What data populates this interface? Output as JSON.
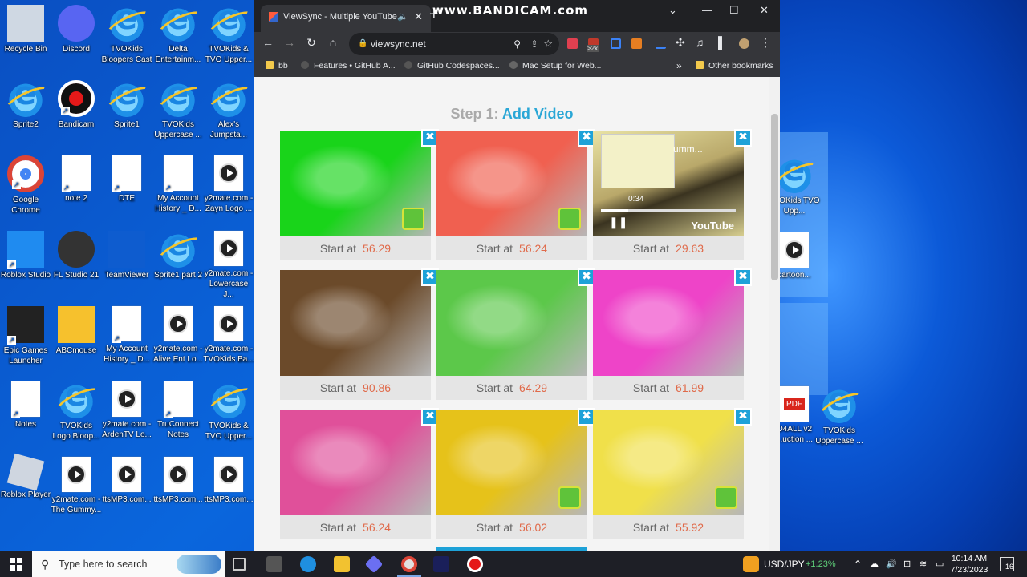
{
  "desktop": {
    "icons": [
      {
        "label": "Recycle Bin",
        "icon": "recycle-bin-icon"
      },
      {
        "label": "Discord",
        "icon": "discord-icon"
      },
      {
        "label": "TVOKids Bloopers Cast",
        "icon": "ie-icon"
      },
      {
        "label": "Delta Entertainm...",
        "icon": "ie-icon"
      },
      {
        "label": "TVOKids & TVO Upper...",
        "icon": "ie-icon"
      },
      {
        "label": "Sprite2",
        "icon": "ie-icon"
      },
      {
        "label": "Bandicam",
        "icon": "bandicam-icon"
      },
      {
        "label": "Sprite1",
        "icon": "ie-icon"
      },
      {
        "label": "TVOKids Uppercase ...",
        "icon": "ie-icon"
      },
      {
        "label": "Alex's Jumpsta...",
        "icon": "ie-icon"
      },
      {
        "label": "Google Chrome",
        "icon": "chrome-icon"
      },
      {
        "label": "note 2",
        "icon": "document-icon"
      },
      {
        "label": "DTE",
        "icon": "document-icon"
      },
      {
        "label": "My Account History _ D...",
        "icon": "document-icon"
      },
      {
        "label": "y2mate.com - Zayn Logo ...",
        "icon": "media-file-icon"
      },
      {
        "label": "Roblox Studio",
        "icon": "roblox-studio-icon"
      },
      {
        "label": "FL Studio 21",
        "icon": "fl-studio-icon"
      },
      {
        "label": "TeamViewer",
        "icon": "teamviewer-icon"
      },
      {
        "label": "Sprite1 part 2",
        "icon": "ie-icon"
      },
      {
        "label": "y2mate.com - Lowercase J...",
        "icon": "media-file-icon"
      },
      {
        "label": "Epic Games Launcher",
        "icon": "epic-games-icon"
      },
      {
        "label": "ABCmouse",
        "icon": "abcmouse-icon"
      },
      {
        "label": "My Account History _ D...",
        "icon": "document-icon"
      },
      {
        "label": "y2mate.com - Alive Ent Lo...",
        "icon": "media-file-icon"
      },
      {
        "label": "y2mate.com - TVOKids Ba...",
        "icon": "media-file-icon"
      },
      {
        "label": "Notes",
        "icon": "document-icon"
      },
      {
        "label": "TVOKids Logo Bloop...",
        "icon": "ie-icon"
      },
      {
        "label": "y2mate.com - ArdenTV Lo...",
        "icon": "media-file-icon"
      },
      {
        "label": "TruConnect Notes",
        "icon": "document-icon"
      },
      {
        "label": "TVOKids & TVO Upper...",
        "icon": "ie-icon"
      },
      {
        "label": "Roblox Player",
        "icon": "roblox-icon"
      },
      {
        "label": "y2mate.com - The Gummy...",
        "icon": "media-file-icon"
      },
      {
        "label": "ttsMP3.com...",
        "icon": "media-file-icon"
      },
      {
        "label": "ttsMP3.com...",
        "icon": "media-file-icon"
      },
      {
        "label": "ttsMP3.com...",
        "icon": "media-file-icon"
      }
    ],
    "right_icons": [
      {
        "label": "TVOKids TVO Upp...",
        "icon": "ie-icon"
      },
      {
        "label": "cartoon...",
        "icon": "media-file-icon"
      },
      {
        "label": "O4ALL v2 ...uction ...",
        "icon": "pdf-icon"
      },
      {
        "label": "TVOKids Uppercase ...",
        "icon": "ie-icon"
      }
    ]
  },
  "browser": {
    "tab_title": "ViewSync - Multiple YouTube",
    "watermark": "www.BANDICAM.com",
    "url": "viewsync.net",
    "new_tab": "+",
    "ext_badge": ">2k",
    "bookmarks": [
      {
        "label": "bb",
        "icon": "folder-icon"
      },
      {
        "label": "Features • GitHub A...",
        "icon": "github-icon"
      },
      {
        "label": "GitHub Codespaces...",
        "icon": "github-icon"
      },
      {
        "label": "Mac Setup for Web...",
        "icon": "apple-icon"
      }
    ],
    "bookmarks_overflow": "»",
    "other_bookmarks": "Other bookmarks"
  },
  "page": {
    "step_prefix": "Step 1:",
    "step_action": "Add Video",
    "start_label": "Start at",
    "close_glyph": "✖",
    "player_title": "umm...",
    "player_time": "0:34",
    "player_brand": "YouTube",
    "videos": [
      {
        "start": "56.29",
        "color": "#19d41a"
      },
      {
        "start": "56.24",
        "color": "#f06050"
      },
      {
        "start": "29.63",
        "color": "#d9d090"
      },
      {
        "start": "90.86",
        "color": "#6b4a2a"
      },
      {
        "start": "64.29",
        "color": "#5cc84a"
      },
      {
        "start": "61.99",
        "color": "#ee44c8"
      },
      {
        "start": "56.24",
        "color": "#e0509a"
      },
      {
        "start": "56.02",
        "color": "#e6c21a"
      },
      {
        "start": "55.92",
        "color": "#f0e04a"
      }
    ]
  },
  "taskbar": {
    "search_placeholder": "Type here to search",
    "ticker_name": "USD/JPY",
    "ticker_change": "+1.23%",
    "time": "10:14 AM",
    "date": "7/23/2023",
    "notif_count": "16"
  }
}
